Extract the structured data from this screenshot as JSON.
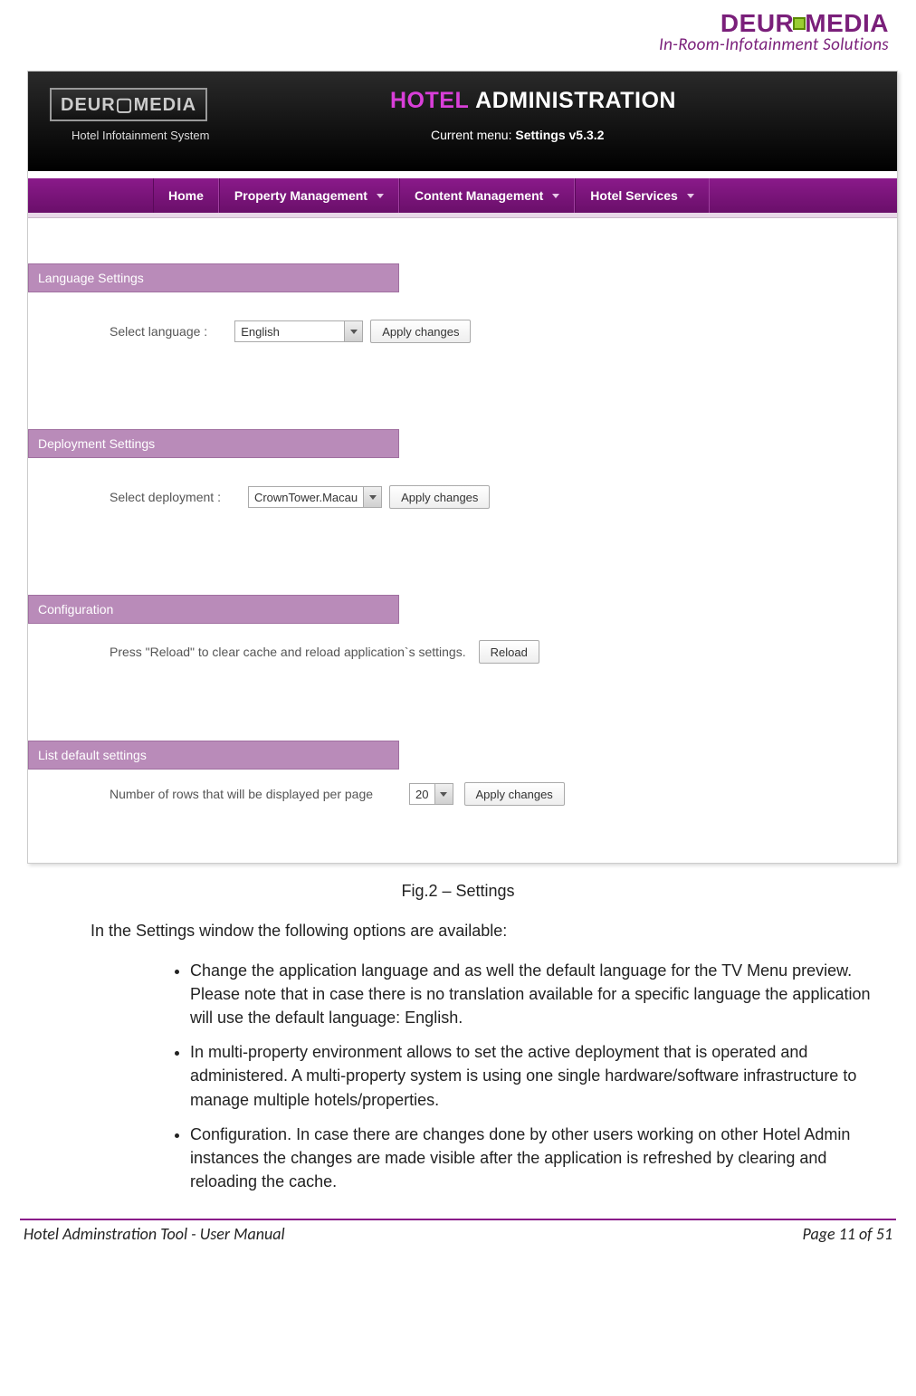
{
  "brand": {
    "name_pre": "DEUR",
    "name_post": "MEDIA",
    "tagline": "In-Room-Infotainment Solutions"
  },
  "app": {
    "logo_text": "DEUR▢MEDIA",
    "logo_sub": "Hotel Infotainment System",
    "title_part1": "HOTEL",
    "title_part2": "ADMINISTRATION",
    "current_menu_label": "Current menu:",
    "current_menu_value": "Settings v5.3.2",
    "nav": [
      {
        "label": "Home",
        "has_menu": false
      },
      {
        "label": "Property Management",
        "has_menu": true
      },
      {
        "label": "Content Management",
        "has_menu": true
      },
      {
        "label": "Hotel Services",
        "has_menu": true
      }
    ]
  },
  "sections": {
    "language": {
      "heading": "Language Settings",
      "label": "Select language :",
      "value": "English",
      "apply": "Apply changes"
    },
    "deployment": {
      "heading": "Deployment Settings",
      "label": "Select deployment :",
      "value": "CrownTower.Macau",
      "apply": "Apply changes"
    },
    "configuration": {
      "heading": "Configuration",
      "text": "Press \"Reload\" to clear cache and reload application`s settings.",
      "button": "Reload"
    },
    "listdefaults": {
      "heading": "List default settings",
      "text": "Number of rows that will be displayed per page",
      "value": "20",
      "apply": "Apply changes"
    }
  },
  "figure_caption": "Fig.2 – Settings",
  "doc": {
    "intro": "In the Settings window the following options are available:",
    "bullets": [
      "Change the application language and as well the default language for the TV Menu preview. Please note that in case there is no translation available for a specific language the application will use the default language: English.",
      "In multi-property environment allows to set the active deployment that is operated and administered. A multi-property system is using one single hardware/software infrastructure to manage multiple hotels/properties.",
      "Configuration. In case there are changes done by other users working on other Hotel Admin instances the changes are made visible after the application is refreshed by clearing and reloading the cache."
    ]
  },
  "footer": {
    "left": "Hotel Adminstration Tool - User Manual",
    "right": "Page 11 of 51"
  }
}
